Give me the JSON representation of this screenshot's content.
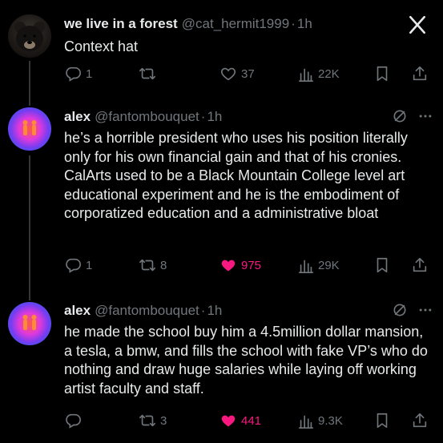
{
  "close_icon": "close-x-icon",
  "tweets": [
    {
      "name": "we live in a forest",
      "handle": "@cat_hermit1999",
      "time": "1h",
      "text": "Context hat",
      "replies": "1",
      "retweets": "",
      "likes": "37",
      "views": "22K",
      "liked": false
    },
    {
      "name": "alex",
      "handle": "@fantombouquet",
      "time": "1h",
      "text": "he’s a horrible president who uses his position literally only for his own financial gain and that of his cronies. CalArts used to be a Black Mountain College level art educational experiment and he is the embodiment of corporatized education and a administrative bloat",
      "replies": "1",
      "retweets": "8",
      "likes": "975",
      "views": "29K",
      "liked": true
    },
    {
      "name": "alex",
      "handle": "@fantombouquet",
      "time": "1h",
      "text": "he made the school buy him a 4.5million dollar mansion, a tesla, a bmw, and fills the school with fake VP’s who do nothing and draw huge salaries while laying off working artist faculty and staff.",
      "replies": "",
      "retweets": "3",
      "likes": "441",
      "views": "9.3K",
      "liked": true
    }
  ],
  "colors": {
    "background": "#000000",
    "text": "#e7e9ea",
    "muted": "#71767b",
    "like": "#f91880"
  }
}
